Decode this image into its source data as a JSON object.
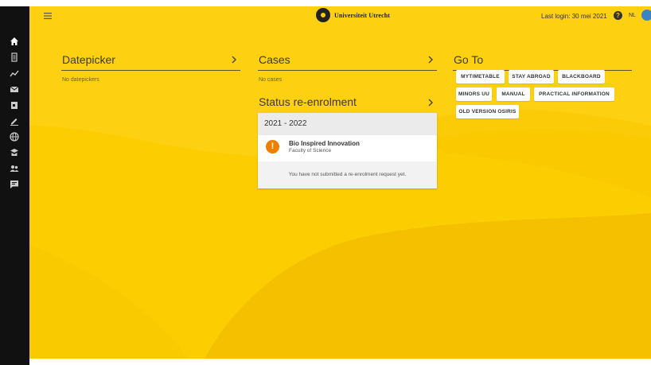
{
  "header": {
    "logo_text": "Universiteit Utrecht",
    "last_login": "Last login: 30 mei 2021",
    "help_symbol": "?",
    "language": "NL"
  },
  "rail": {
    "items": [
      {
        "name": "home-icon",
        "active": true
      },
      {
        "name": "list-icon"
      },
      {
        "name": "progress-chart-icon"
      },
      {
        "name": "mail-icon"
      },
      {
        "name": "calendar-icon"
      },
      {
        "name": "edit-icon"
      },
      {
        "name": "globe-icon"
      },
      {
        "name": "graduation-icon"
      },
      {
        "name": "group-icon"
      },
      {
        "name": "feedback-icon"
      }
    ]
  },
  "datepicker": {
    "title": "Datepicker",
    "empty_text": "No datepickers"
  },
  "cases": {
    "title": "Cases",
    "empty_text": "No cases"
  },
  "goto": {
    "title": "Go To",
    "links": [
      "MYTIMETABLE",
      "STAY ABROAD",
      "BLACKBOARD",
      "MINORS UU",
      "MANUAL",
      "PRACTICAL INFORMATION",
      "OLD VERSION OSIRIS"
    ]
  },
  "reenrolment": {
    "title": "Status re-enrolment",
    "year": "2021 - 2022",
    "warning_symbol": "!",
    "programme": "Bio Inspired Innovation",
    "faculty": "Faculty of Science",
    "message": "You have not submitted a re-enrolment request yet."
  },
  "colors": {
    "brand_yellow": "#fccd00",
    "rail_black": "#111111",
    "warning_orange": "#ee7f00",
    "avatar_blue": "#3b83c4"
  }
}
